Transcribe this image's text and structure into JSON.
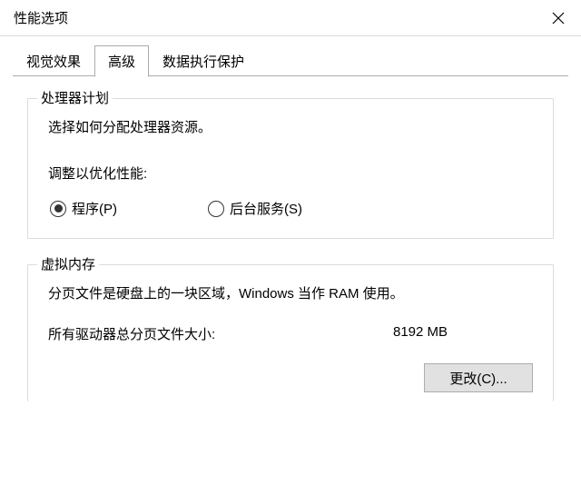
{
  "titlebar": {
    "title": "性能选项"
  },
  "tabs": {
    "visual": "视觉效果",
    "advanced": "高级",
    "dep": "数据执行保护"
  },
  "scheduling": {
    "legend": "处理器计划",
    "desc": "选择如何分配处理器资源。",
    "adjustLabel": "调整以优化性能:",
    "radios": {
      "programs": "程序(P)",
      "background": "后台服务(S)"
    }
  },
  "vm": {
    "legend": "虚拟内存",
    "desc": "分页文件是硬盘上的一块区域，Windows 当作 RAM 使用。",
    "sizeLabel": "所有驱动器总分页文件大小:",
    "sizeValue": "8192 MB",
    "changeBtn": "更改(C)..."
  }
}
